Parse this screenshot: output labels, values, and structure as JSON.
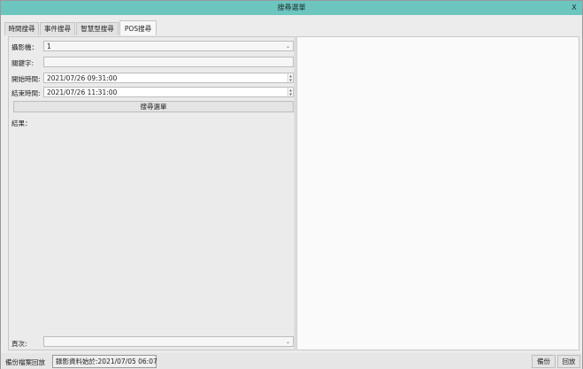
{
  "window": {
    "title": "搜尋選單",
    "close_label": "X"
  },
  "tabs": [
    {
      "label": "時間搜尋"
    },
    {
      "label": "事件搜尋"
    },
    {
      "label": "智慧型搜尋"
    },
    {
      "label": "POS搜尋",
      "active": true
    }
  ],
  "form": {
    "camera_label": "攝影機：",
    "camera_value": "1",
    "keyword_label": "關鍵字:",
    "keyword_value": "",
    "start_label": "開始時間:",
    "start_value": "2021/07/26 09:31:00",
    "end_label": "結束時間:",
    "end_value": "2021/07/26 11:31:00",
    "search_button": "搜尋選單",
    "result_label": "結果：",
    "page_label": "頁次:",
    "page_value": ""
  },
  "status": {
    "backup_playback_label": "備份檔案回放",
    "recording_start": "錄影資料始於:2021/07/05 06:07",
    "backup_button": "備份",
    "playback_button": "回放"
  },
  "icons": {
    "dropdown": "chevron-down-icon",
    "spinner": "spin-updown-icon"
  }
}
